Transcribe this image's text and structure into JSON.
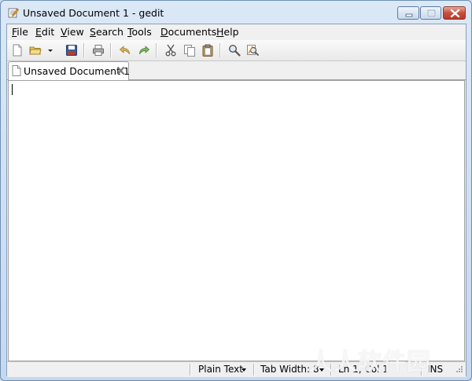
{
  "window": {
    "title": "Unsaved Document 1 - gedit",
    "buttons": {
      "minimize": "minimize-icon",
      "maximize": "maximize-icon",
      "close": "close-icon"
    }
  },
  "menubar": {
    "items": [
      {
        "label": "File",
        "mnemonic": "F",
        "rest": "ile"
      },
      {
        "label": "Edit",
        "mnemonic": "E",
        "rest": "dit"
      },
      {
        "label": "View",
        "mnemonic": "V",
        "rest": "iew"
      },
      {
        "label": "Search",
        "mnemonic": "S",
        "rest": "earch"
      },
      {
        "label": "Tools",
        "mnemonic": "T",
        "rest": "ools"
      },
      {
        "label": "Documents",
        "mnemonic": "D",
        "rest": "ocuments"
      },
      {
        "label": "Help",
        "mnemonic": "H",
        "rest": "elp"
      }
    ]
  },
  "toolbar": {
    "icons": [
      "new-document-icon",
      "open-folder-icon",
      "open-recent-dropdown-icon",
      "save-icon",
      "print-icon",
      "undo-icon",
      "redo-icon",
      "cut-icon",
      "copy-icon",
      "paste-icon",
      "find-icon",
      "find-replace-icon"
    ]
  },
  "tabs": [
    {
      "label": "Unsaved Document 1"
    }
  ],
  "statusbar": {
    "language": "Plain Text",
    "tab_width": "Tab Width: 8",
    "position": "Ln 1, Col 1",
    "mode": "INS"
  },
  "watermark": "人人软件园"
}
